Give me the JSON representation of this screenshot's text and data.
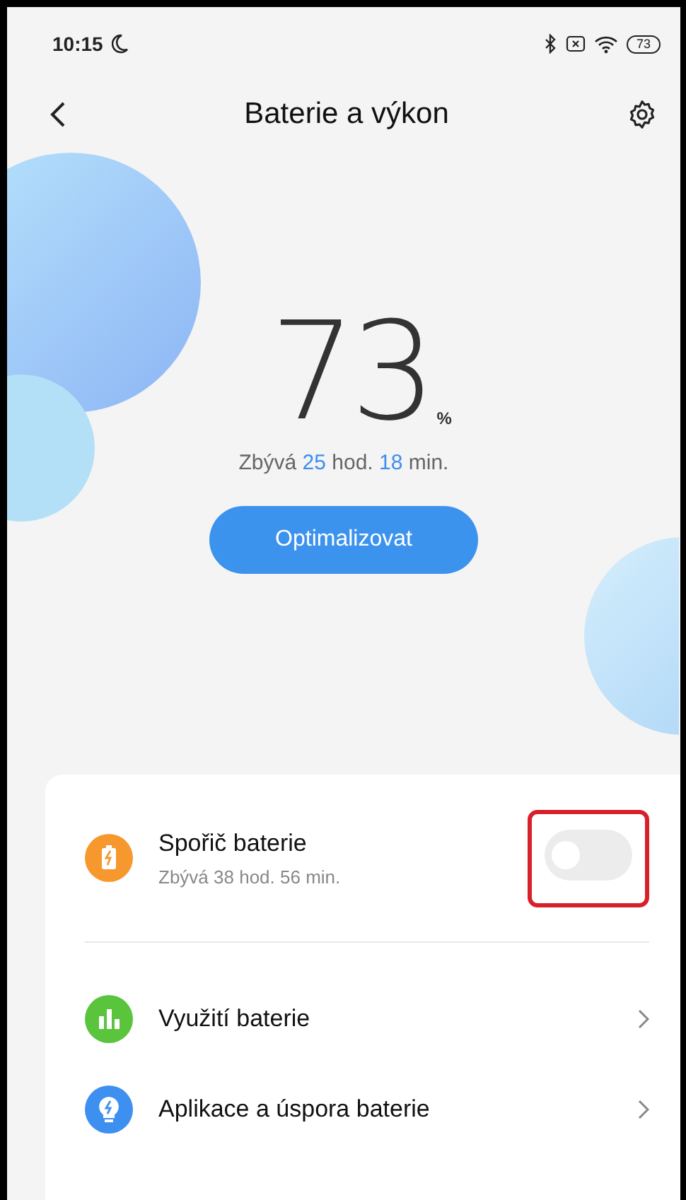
{
  "status_bar": {
    "time": "10:15",
    "battery": "73"
  },
  "header": {
    "title": "Baterie a výkon"
  },
  "battery": {
    "percent": "73",
    "unit": "%",
    "remaining": [
      {
        "text": "Zbývá",
        "accent": false
      },
      {
        "text": "25",
        "accent": true
      },
      {
        "text": "hod.",
        "accent": false
      },
      {
        "text": "18",
        "accent": true
      },
      {
        "text": "min.",
        "accent": false
      }
    ],
    "button": "Optimalizovat"
  },
  "items": [
    {
      "kind": "toggle",
      "color": "#f7982f",
      "title": "Spořič baterie",
      "subtitle": "Zbývá 38 hod. 56 min.",
      "on": false,
      "highlighted": true
    },
    {
      "kind": "link",
      "color": "#5ac43c",
      "title": "Využití baterie"
    },
    {
      "kind": "link",
      "color": "#3d8ff0",
      "title": "Aplikace a úspora baterie"
    }
  ]
}
